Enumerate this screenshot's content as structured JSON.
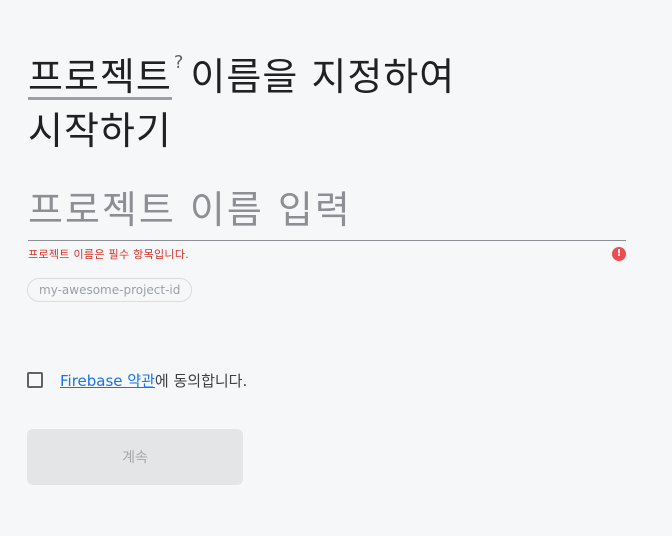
{
  "heading": {
    "term": "프로젝트",
    "help_icon": "question-circle-icon",
    "rest_line1": "이름을 지정하여",
    "line2": "시작하기"
  },
  "name_field": {
    "value": "",
    "placeholder": "프로젝트 이름 입력"
  },
  "validation": {
    "error": "프로젝트 이름은 필수 항목입니다.",
    "error_icon": "error-circle-icon",
    "error_color": "#d93025"
  },
  "project_id": {
    "placeholder": "my-awesome-project-id"
  },
  "terms": {
    "checked": false,
    "link_text": "Firebase 약관",
    "suffix": "에 동의합니다."
  },
  "actions": {
    "continue_label": "계속",
    "continue_disabled": true
  },
  "colors": {
    "link": "#1a73e8",
    "background": "#f6f7f9",
    "error": "#ea4e4e"
  }
}
